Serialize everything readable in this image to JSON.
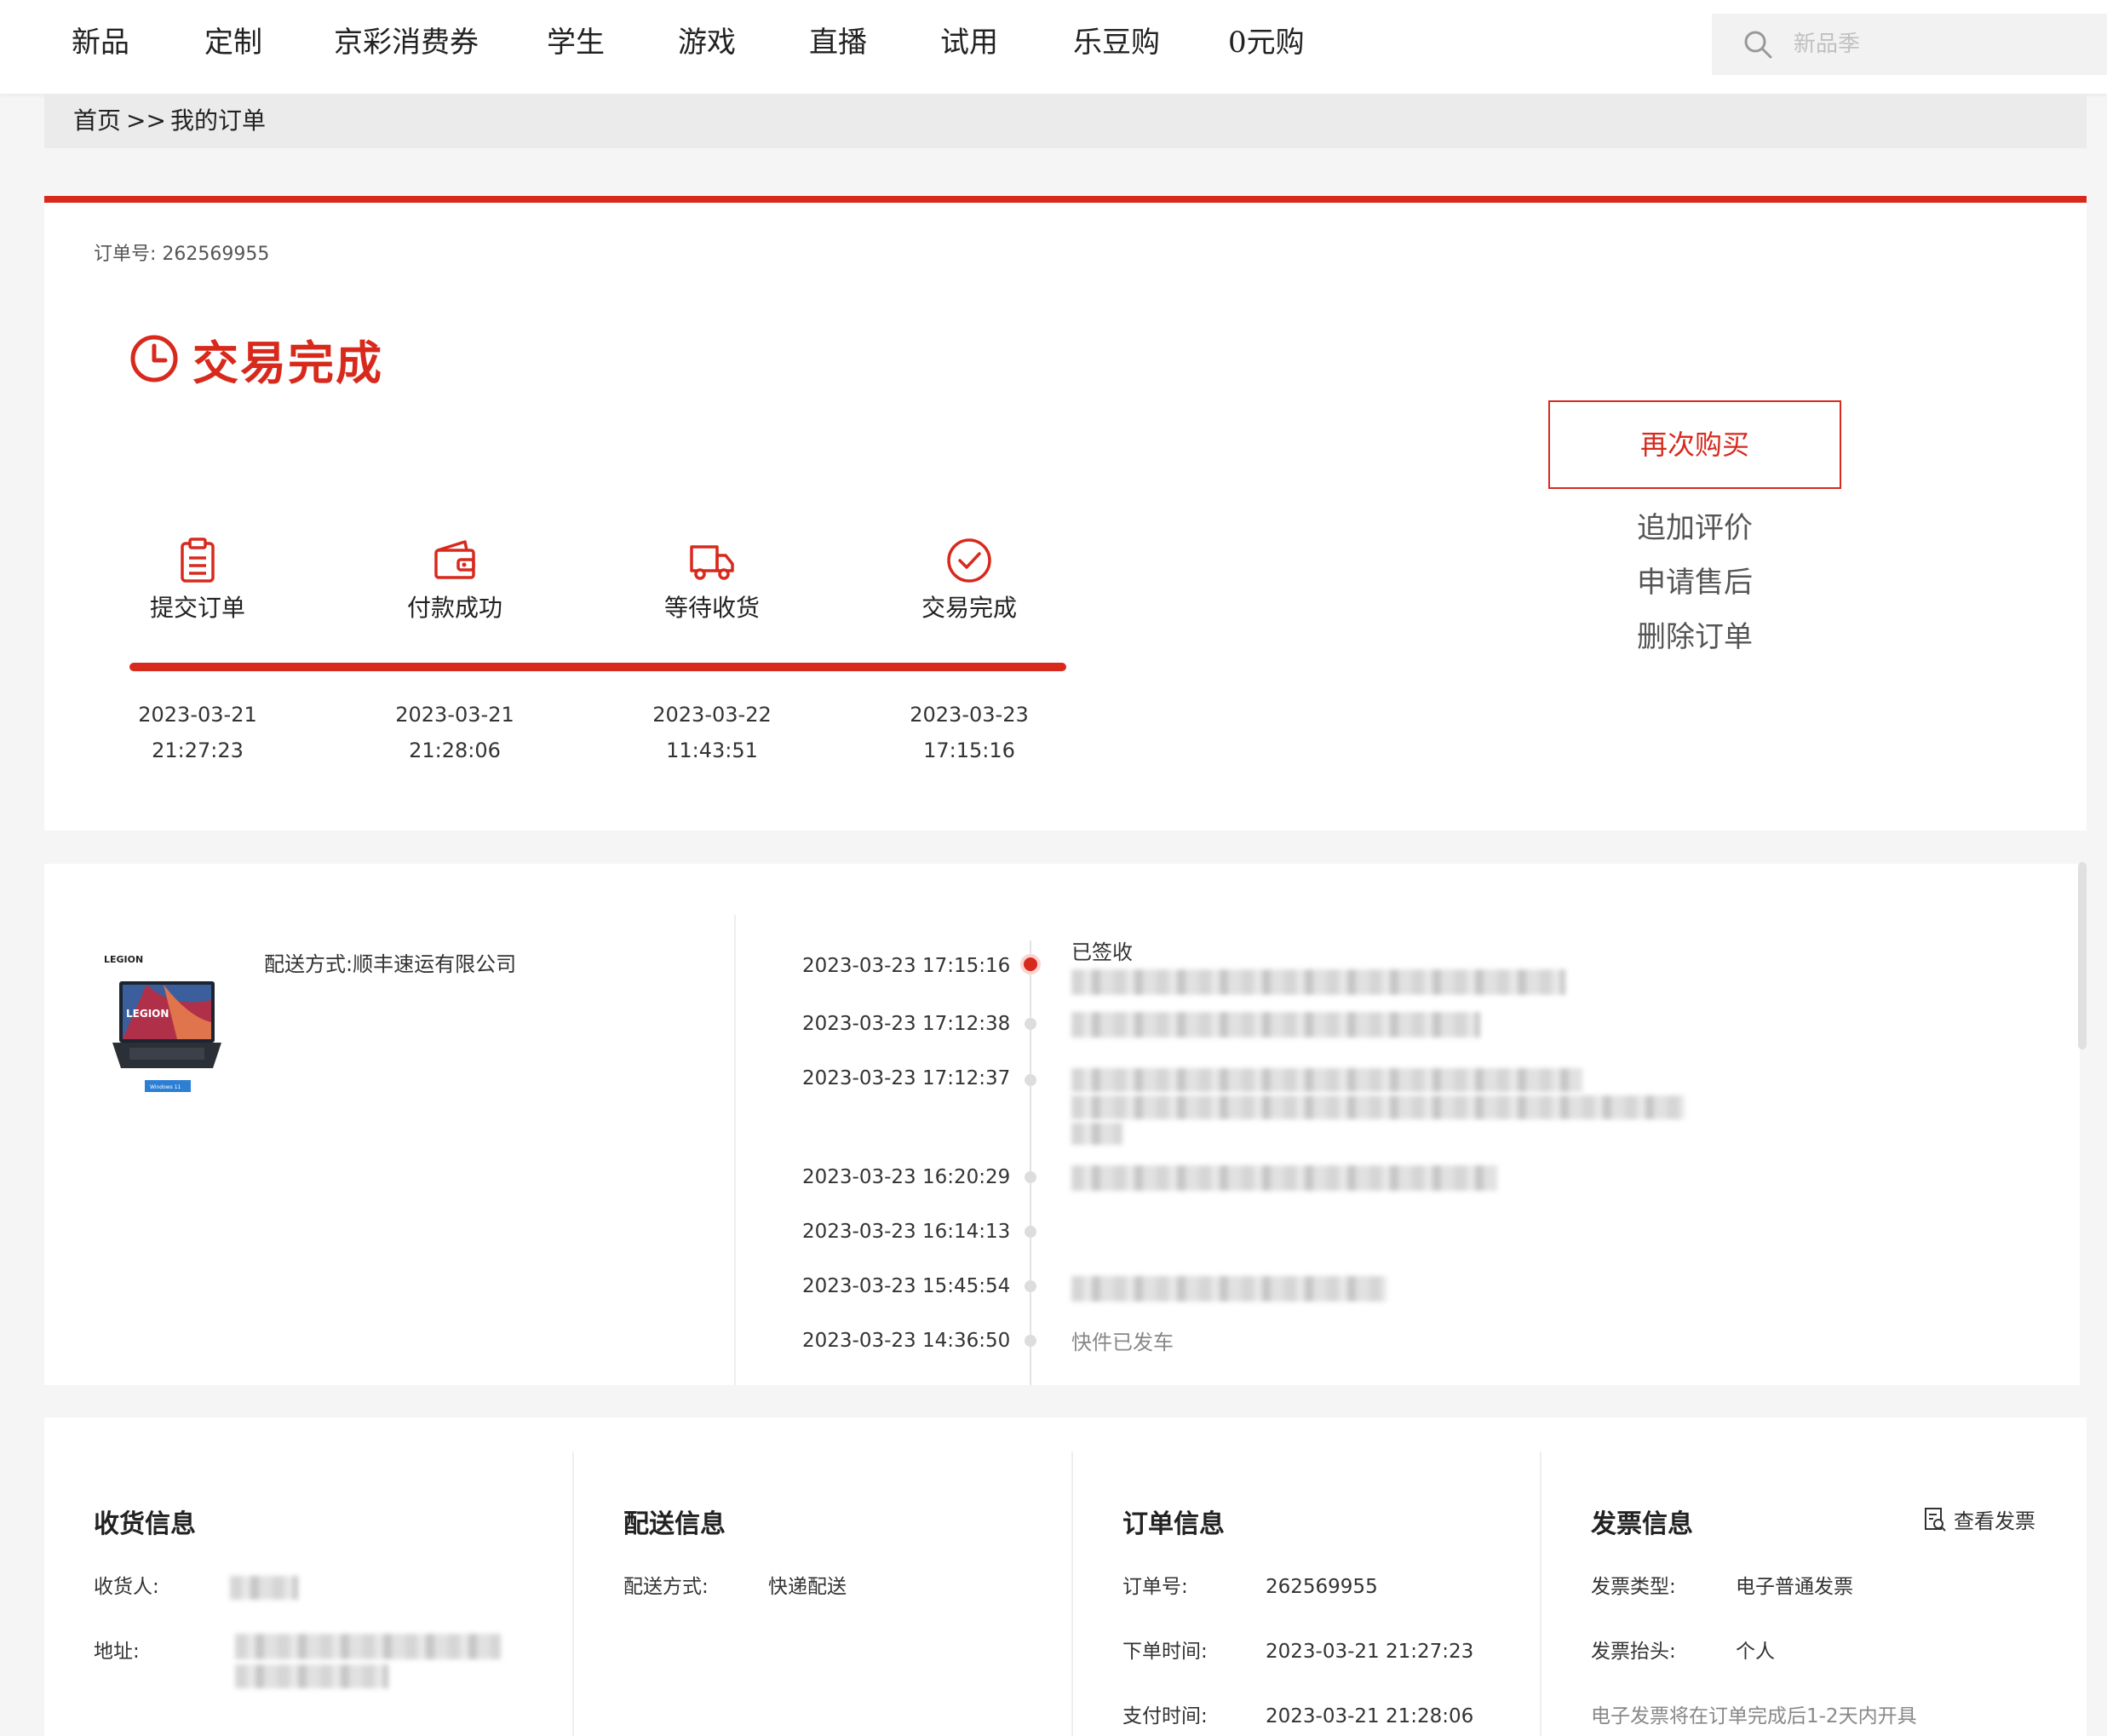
{
  "nav": {
    "items": [
      "新品",
      "定制",
      "京彩消费券",
      "学生",
      "游戏",
      "直播",
      "试用",
      "乐豆购",
      "0元购"
    ],
    "search_placeholder": "新品季"
  },
  "breadcrumb": {
    "home": "首页",
    "separator": ">>",
    "current": "我的订单"
  },
  "order": {
    "number_label": "订单号: 262569955",
    "status": "交易完成",
    "steps": [
      {
        "label": "提交订单",
        "icon": "clipboard-icon",
        "date": "2023-03-21",
        "time": "21:27:23"
      },
      {
        "label": "付款成功",
        "icon": "wallet-icon",
        "date": "2023-03-21",
        "time": "21:28:06"
      },
      {
        "label": "等待收货",
        "icon": "truck-icon",
        "date": "2023-03-22",
        "time": "11:43:51"
      },
      {
        "label": "交易完成",
        "icon": "check-circle-icon",
        "date": "2023-03-23",
        "time": "17:15:16"
      }
    ],
    "progress": 1.0,
    "actions": {
      "buy_again": "再次购买",
      "add_review": "追加评价",
      "after_sales": "申请售后",
      "delete_order": "删除订单"
    }
  },
  "logistics": {
    "delivery_method": "配送方式:顺丰速运有限公司",
    "timeline": [
      {
        "time": "2023-03-23 17:15:16",
        "status": "已签收"
      },
      {
        "time": "2023-03-23 17:12:38",
        "status": ""
      },
      {
        "time": "2023-03-23 17:12:37",
        "status": ""
      },
      {
        "time": "2023-03-23 16:20:29",
        "status": ""
      },
      {
        "time": "2023-03-23 16:14:13",
        "status": ""
      },
      {
        "time": "2023-03-23 15:45:54",
        "status": ""
      },
      {
        "time": "2023-03-23 14:36:50",
        "status": "快件已发车"
      }
    ]
  },
  "info": {
    "receiver": {
      "title": "收货信息",
      "receiver_label": "收货人:",
      "address_label": "地址:"
    },
    "shipping": {
      "title": "配送信息",
      "method_label": "配送方式:",
      "method_value": "快递配送"
    },
    "order": {
      "title": "订单信息",
      "number_label": "订单号:",
      "number_value": "262569955",
      "created_label": "下单时间:",
      "created_value": "2023-03-21 21:27:23",
      "paid_label": "支付时间:",
      "paid_value": "2023-03-21 21:28:06"
    },
    "invoice": {
      "title": "发票信息",
      "view_label": "查看发票",
      "type_label": "发票类型:",
      "type_value": "电子普通发票",
      "header_label": "发票抬头:",
      "header_value": "个人",
      "note": "电子发票将在订单完成后1-2天内开具"
    }
  },
  "colors": {
    "accent": "#d8291d",
    "background": "#f5f5f5"
  }
}
